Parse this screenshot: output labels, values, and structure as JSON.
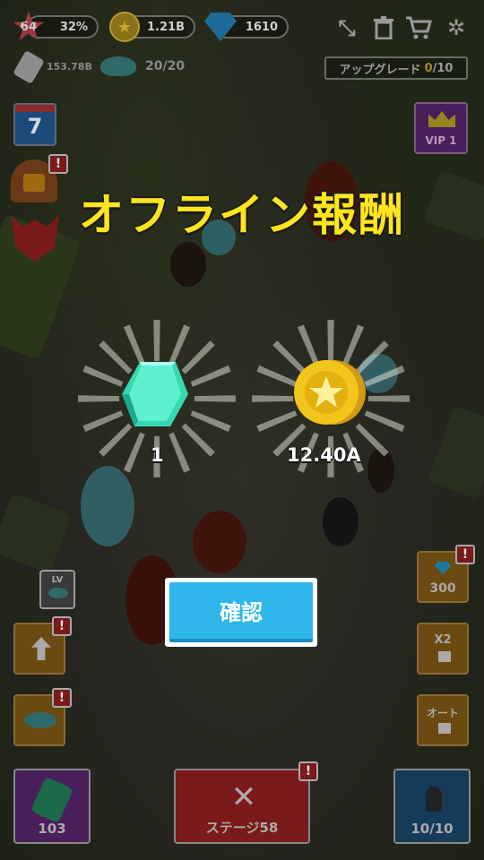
{
  "hud": {
    "level": "64",
    "progress": "32%",
    "progress_value": 0.32,
    "coins": "1.21B",
    "gems": "1610",
    "dps": "153.78B",
    "bat_count": "20/20"
  },
  "upgrade": {
    "label": "アップグレード",
    "current": "0",
    "total": "/10"
  },
  "left_side": {
    "calendar_day": "7"
  },
  "vip": {
    "label": "VIP 1"
  },
  "popup": {
    "title": "オフライン報酬",
    "gem_amount": "1",
    "coin_amount": "12.40A",
    "confirm_label": "確認"
  },
  "right_side": {
    "gem_offer": "300",
    "double_label": "X2",
    "auto_label": "オート"
  },
  "left_buttons": {
    "lv_label": "LV"
  },
  "bottom": {
    "gem_count": "103",
    "stage_label": "ステージ58",
    "army_count": "10/10"
  },
  "colors": {
    "title": "#ffe51f",
    "confirm": "#2fb6ea",
    "gem": "#3ee6c0",
    "coin": "#f2c51d"
  }
}
